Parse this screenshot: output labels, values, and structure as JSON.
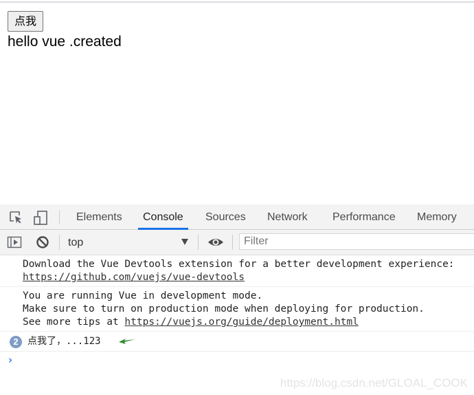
{
  "page": {
    "button_label": "点我",
    "message": "hello vue .created"
  },
  "devtools": {
    "tabs": [
      {
        "label": "Elements",
        "active": false
      },
      {
        "label": "Console",
        "active": true
      },
      {
        "label": "Sources",
        "active": false
      },
      {
        "label": "Network",
        "active": false
      },
      {
        "label": "Performance",
        "active": false
      },
      {
        "label": "Memory",
        "active": false
      }
    ],
    "toolbar": {
      "context": "top",
      "filter_placeholder": "Filter",
      "filter_value": ""
    },
    "console": {
      "messages": [
        {
          "lines": [
            {
              "text": "Download the Vue Devtools extension for a better development experience:",
              "link": null
            },
            {
              "text": "",
              "link": "https://github.com/vuejs/vue-devtools"
            }
          ]
        },
        {
          "lines": [
            {
              "text": "You are running Vue in development mode.",
              "link": null
            },
            {
              "text": "Make sure to turn on production mode when deploying for production.",
              "link": null
            },
            {
              "text": "See more tips at ",
              "link": "https://vuejs.org/guide/deployment.html"
            }
          ]
        }
      ],
      "repeated": {
        "count": "2",
        "text": "点我了，...123"
      },
      "prompt_symbol": "›"
    },
    "accent_color": "#1a73e8"
  },
  "watermark": "https://blog.csdn.net/GLOAL_COOK"
}
